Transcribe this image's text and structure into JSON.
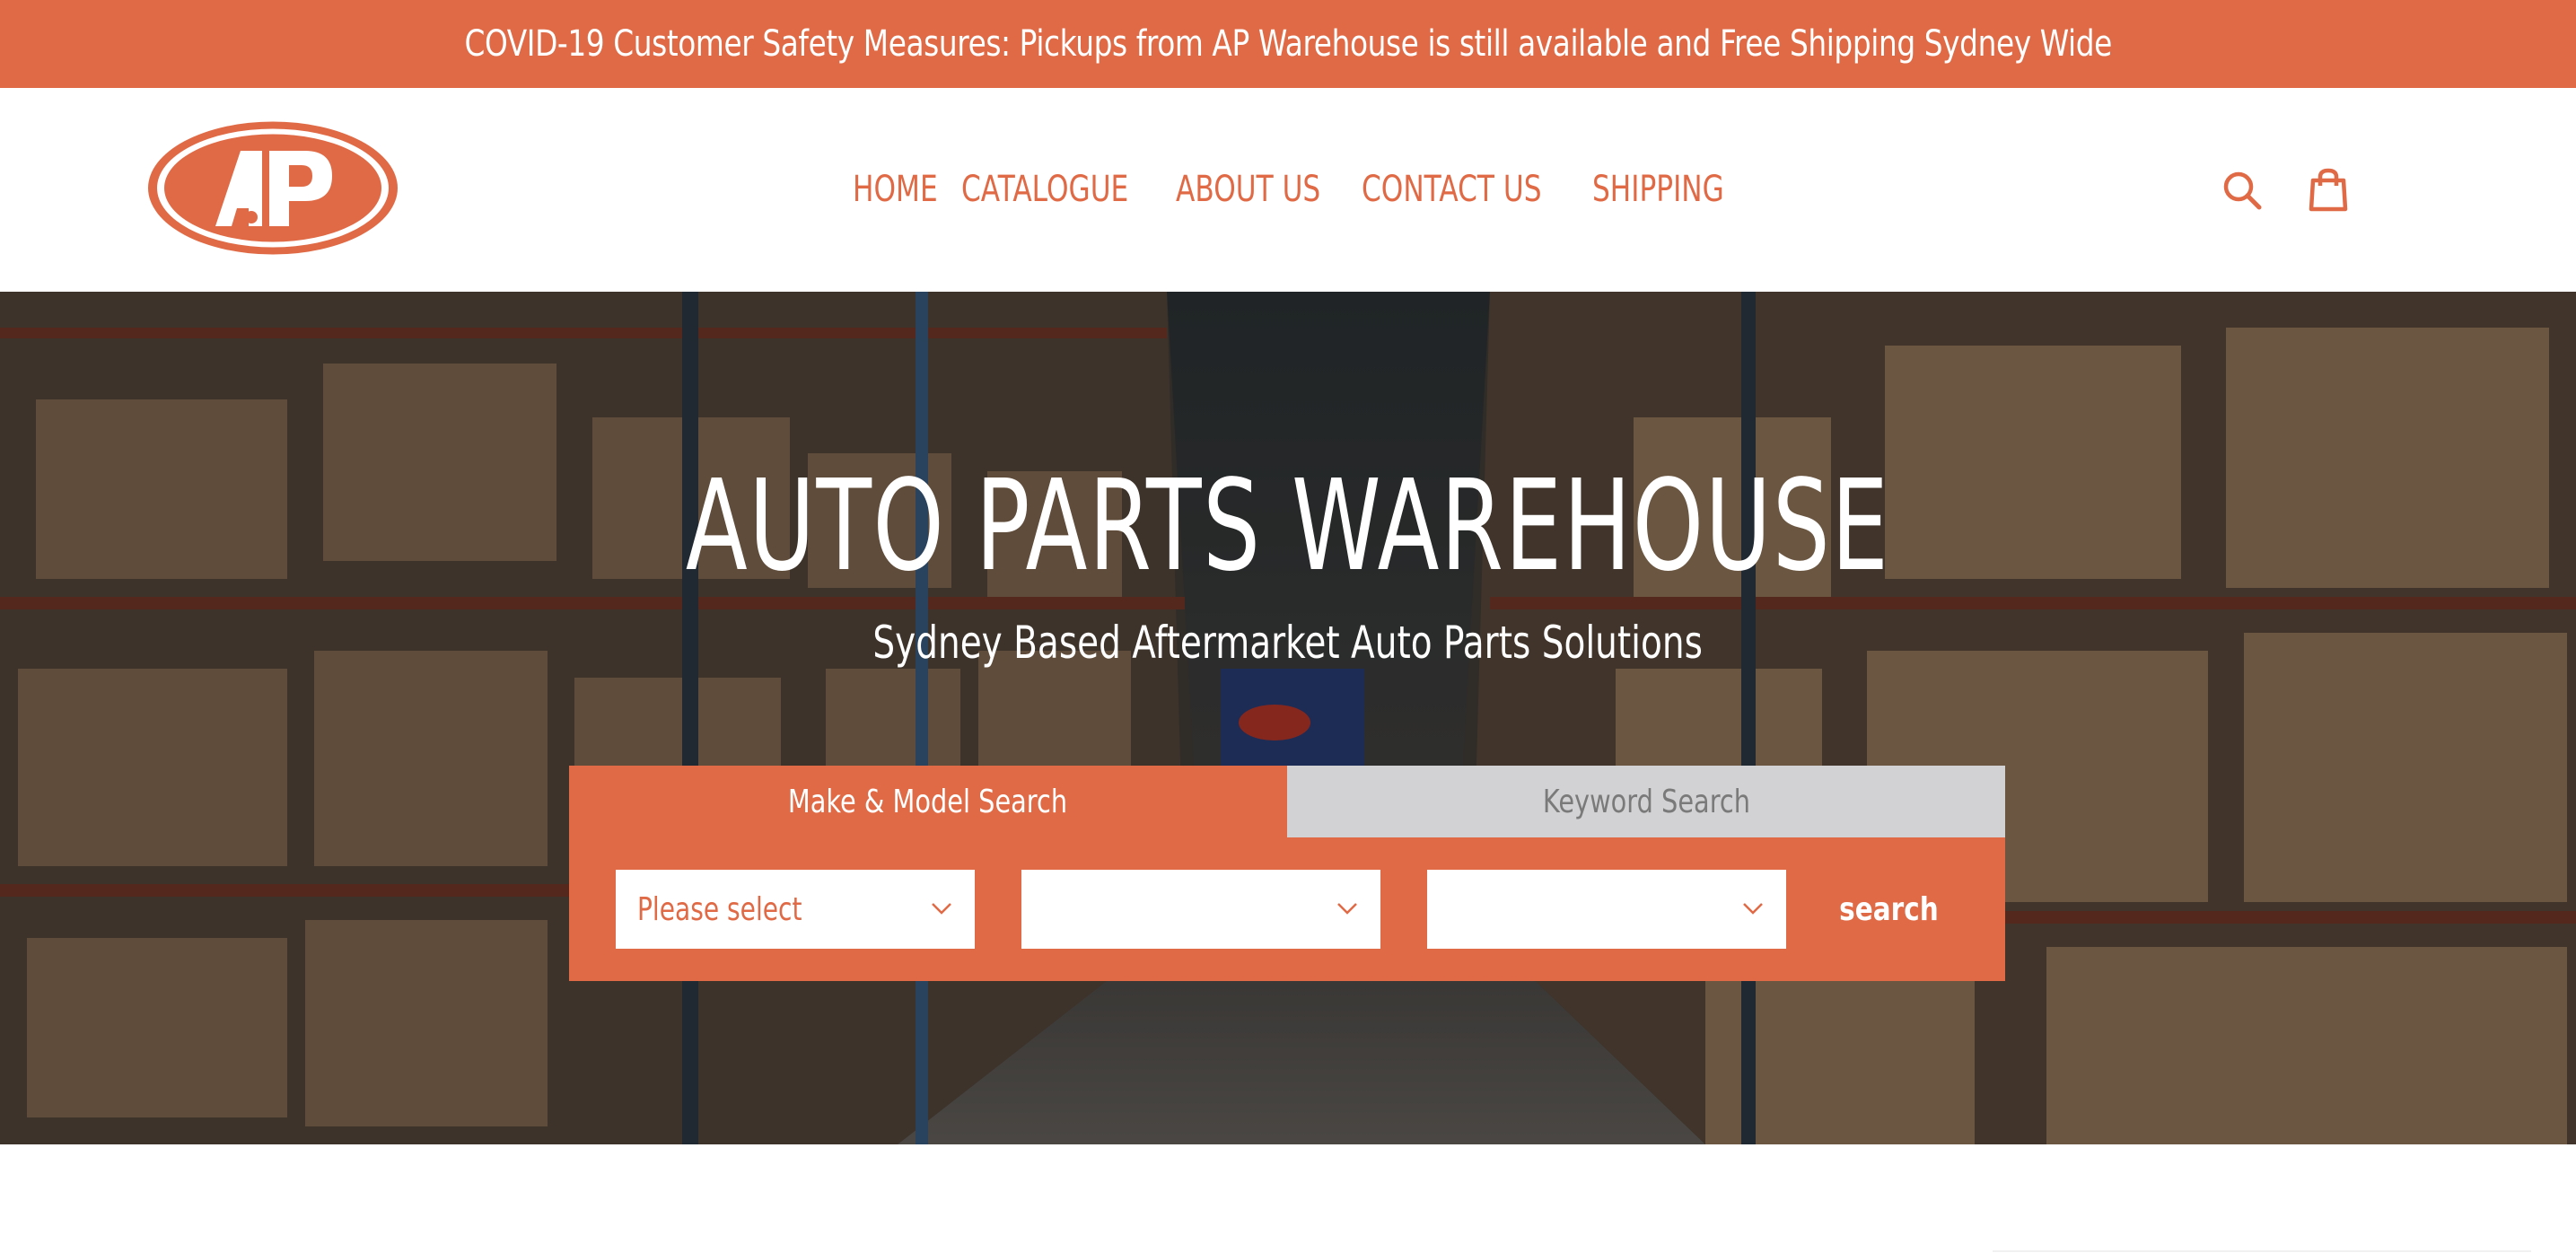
{
  "announcement": {
    "text": "COVID-19 Customer Safety Measures: Pickups from AP Warehouse is still available and Free Shipping Sydney Wide"
  },
  "logo": {
    "text": "AP"
  },
  "nav": {
    "items": [
      {
        "label": "HOME"
      },
      {
        "label": "CATALOGUE"
      },
      {
        "label": "ABOUT US"
      },
      {
        "label": "CONTACT US"
      },
      {
        "label": "SHIPPING"
      }
    ]
  },
  "header_icons": {
    "search": "search-icon",
    "cart": "shopping-bag-icon"
  },
  "hero": {
    "title": "AUTO PARTS WAREHOUSE",
    "subtitle": "Sydney Based Aftermarket Auto Parts Solutions"
  },
  "search": {
    "tabs": [
      {
        "label": "Make & Model Search",
        "active": true
      },
      {
        "label": "Keyword Search",
        "active": false
      }
    ],
    "selects": [
      {
        "value": "Please select"
      },
      {
        "value": ""
      },
      {
        "value": ""
      }
    ],
    "button_label": "search"
  },
  "colors": {
    "brand": "#e06a45",
    "tab_inactive": "#d2d2d4",
    "white": "#ffffff"
  }
}
